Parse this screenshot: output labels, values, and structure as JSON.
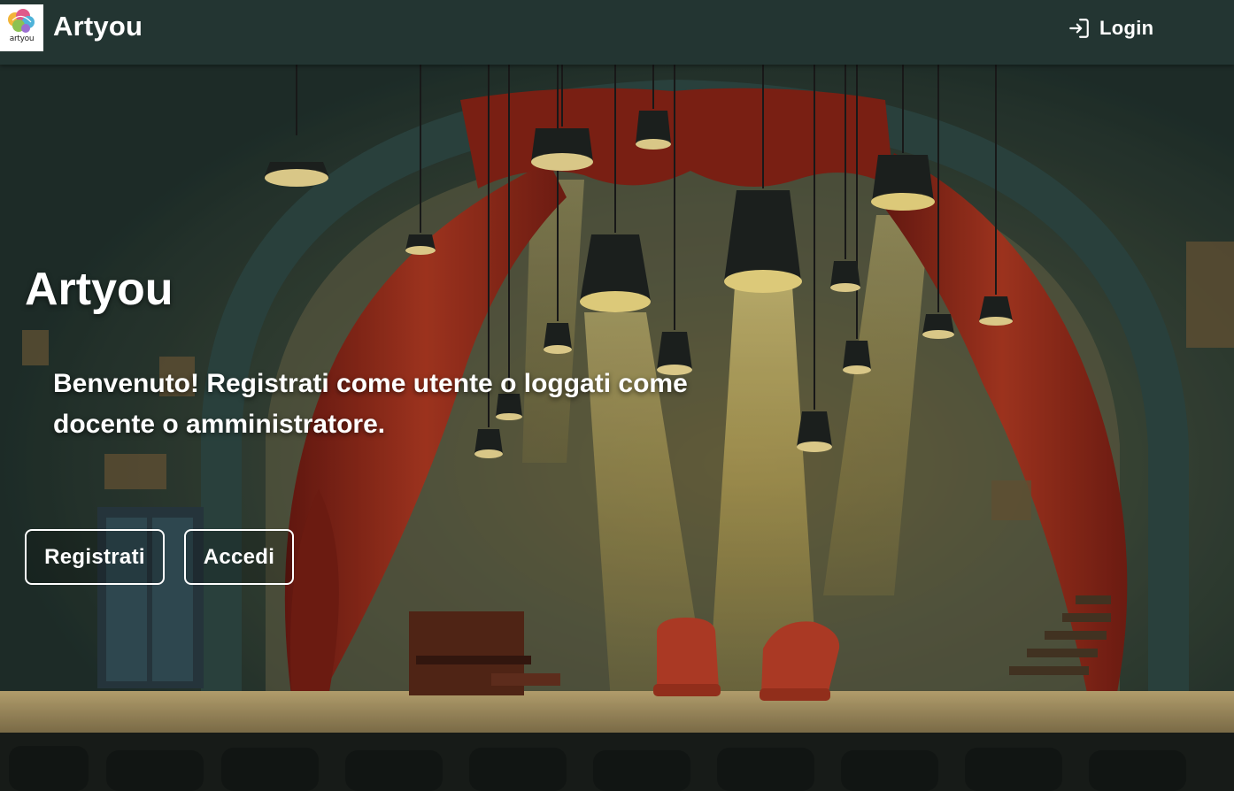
{
  "header": {
    "brand": "Artyou",
    "logo_text": "artyou",
    "login_label": "Login",
    "login_icon": "login-icon",
    "background_color": "#233532"
  },
  "hero": {
    "title": "Artyou",
    "subtitle": "Benvenuto! Registrati come utente o loggati come docente o amministratore.",
    "buttons": {
      "register_label": "Registrati",
      "signin_label": "Accedi"
    }
  },
  "colors": {
    "curtain": "#9a2a1c",
    "light": "#f2d46a",
    "wall": "#3c5652"
  }
}
